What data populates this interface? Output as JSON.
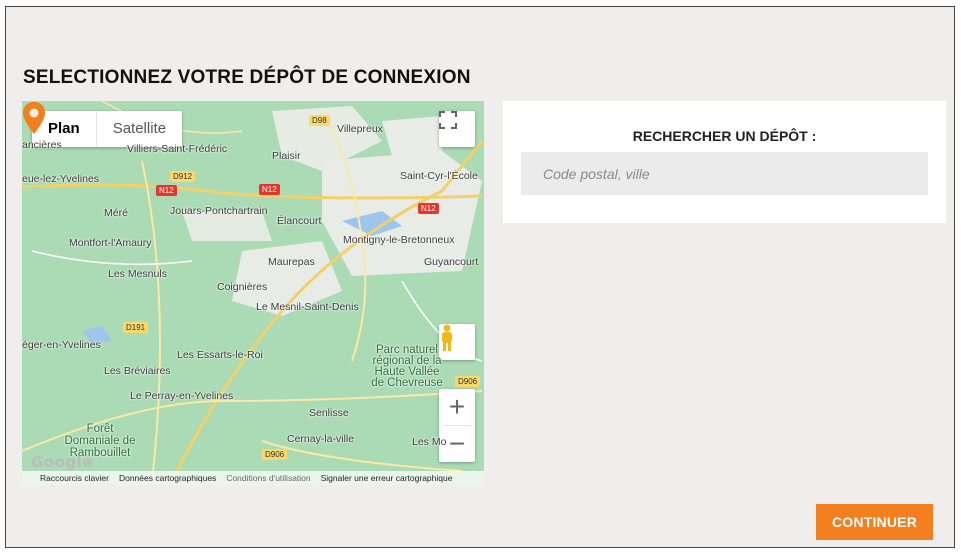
{
  "page": {
    "title": "SELECTIONNEZ VOTRE DÉPÔT DE CONNEXION"
  },
  "map": {
    "type_buttons": {
      "plan": "Plan",
      "satellite": "Satellite"
    },
    "places": [
      "Villepreux",
      "Villiers-Saint-Frédéric",
      "Plaisir",
      "Saint-Cyr-l'École",
      "Jouars-Pontchartrain",
      "Élancourt",
      "Méré",
      "Montigny-le-Bretonneux",
      "Montfort-l'Amaury",
      "Maurepas",
      "Guyancourt",
      "Les Mesnuls",
      "Coignières",
      "Le Mesnil-Saint-Denis",
      "Les Essarts-le-Roi",
      "Les Bréviaires",
      "Le Perray-en-Yvelines",
      "Senlisse",
      "Cernay-la-ville",
      "Les Mo",
      "eue-lez-Yvelines",
      "ancières",
      "éger-en-Yvelines"
    ],
    "green_areas": [
      "Parc naturel régional de la Haute Vallée de Chevreuse",
      "Forêt Domaniale de Rambouillet"
    ],
    "roads": [
      "D98",
      "D912",
      "N12",
      "N12",
      "N12",
      "D191",
      "D906",
      "D906"
    ],
    "attribution": {
      "shortcuts": "Raccourcis clavier",
      "data": "Données cartographiques",
      "terms": "Conditions d'utilisation",
      "report": "Signaler une erreur cartographique"
    },
    "logo": "Google",
    "zoom_in": "+",
    "zoom_out": "−"
  },
  "search": {
    "label": "RECHERCHER UN DÉPÔT :",
    "placeholder": "Code postal, ville",
    "value": ""
  },
  "actions": {
    "continue_label": "CONTINUER"
  },
  "colors": {
    "accent": "#f47f1e",
    "marker": "#f47f1e",
    "map_green": "#aadbb4",
    "modal_bg": "#efeeec"
  }
}
